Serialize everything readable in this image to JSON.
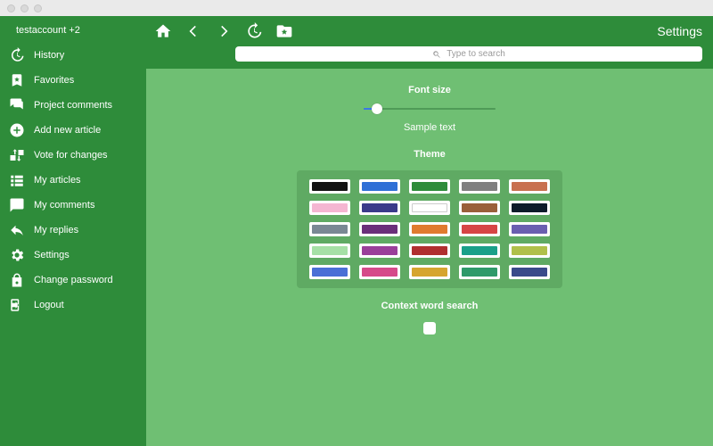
{
  "user": {
    "name": "testaccount",
    "extra": "+2"
  },
  "sidebar": {
    "items": [
      {
        "label": "History"
      },
      {
        "label": "Favorites"
      },
      {
        "label": "Project comments"
      },
      {
        "label": "Add new article"
      },
      {
        "label": "Vote for changes"
      },
      {
        "label": "My articles"
      },
      {
        "label": "My comments"
      },
      {
        "label": "My replies"
      },
      {
        "label": "Settings"
      },
      {
        "label": "Change password"
      },
      {
        "label": "Logout"
      }
    ]
  },
  "header": {
    "title": "Settings"
  },
  "search": {
    "placeholder": "Type to search"
  },
  "settings": {
    "font_size_label": "Font size",
    "sample_text": "Sample text",
    "slider_percent": 10,
    "theme_label": "Theme",
    "context_label": "Context word search",
    "context_checked": false,
    "themes": [
      "#111111",
      "#2e6fd6",
      "#2e8c3a",
      "#7f7f7f",
      "#c8704f",
      "#f5b6d2",
      "#3a3a8a",
      "#ffffff",
      "#9a5f3a",
      "#0d1b2a",
      "#7a8894",
      "#6a2f7a",
      "#e07b2f",
      "#d64545",
      "#6a5fb0",
      "#a6e0a6",
      "#9a3f9a",
      "#b02f2f",
      "#1aa089",
      "#b0c04a",
      "#4a6fd6",
      "#d64a8a",
      "#d6a52f",
      "#2f9a6a",
      "#3a4a8a"
    ]
  },
  "colors": {
    "sidebar_bg": "#2e8c3a",
    "content_bg": "#6fbf73",
    "panel_bg": "#5faa63"
  }
}
